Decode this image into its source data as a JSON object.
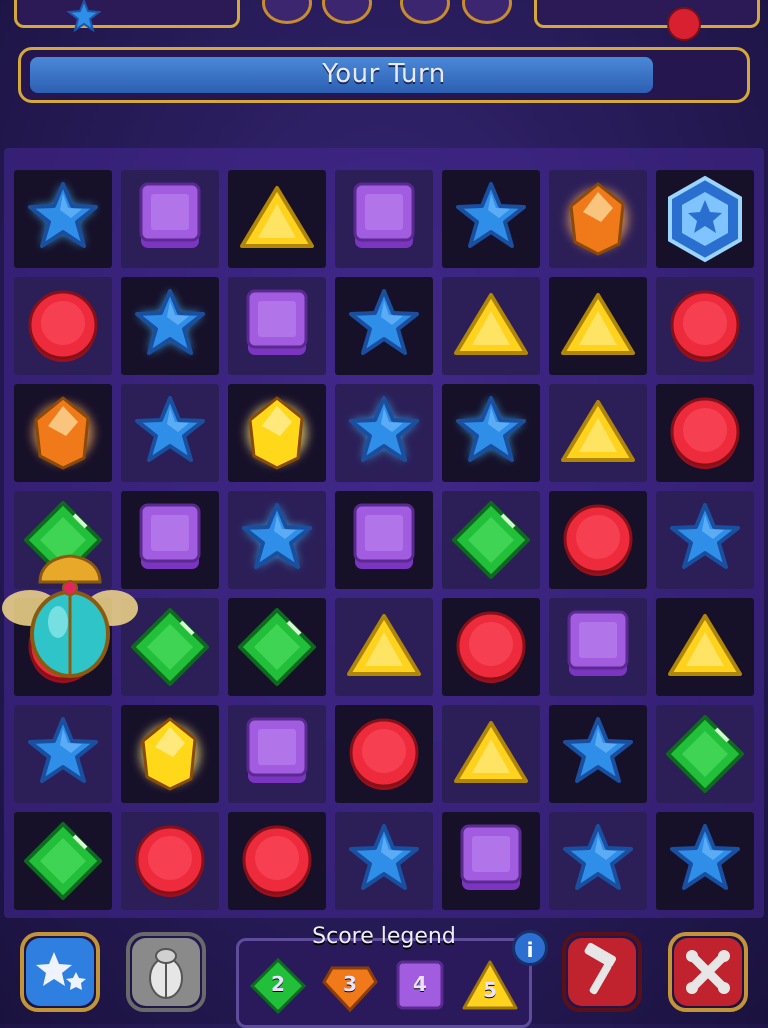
{
  "turn_indicator": {
    "label": "Your Turn",
    "timer_fraction": 0.88
  },
  "board": {
    "rows": 7,
    "cols": 7,
    "grid": [
      [
        "star-glow",
        "square",
        "triangle",
        "square",
        "star",
        "crystal-orange",
        "hex-star"
      ],
      [
        "circle",
        "star-glow",
        "square",
        "star",
        "triangle",
        "triangle",
        "circle"
      ],
      [
        "crystal-orange",
        "star",
        "crystal-yellow",
        "star-glow",
        "star-glow",
        "triangle",
        "circle"
      ],
      [
        "diamond",
        "square",
        "star-glow",
        "square",
        "diamond",
        "circle",
        "star"
      ],
      [
        "circle",
        "diamond",
        "diamond",
        "triangle",
        "circle",
        "square",
        "triangle"
      ],
      [
        "star",
        "crystal-yellow",
        "square",
        "circle",
        "triangle",
        "star",
        "diamond"
      ],
      [
        "diamond",
        "circle",
        "circle",
        "star",
        "square",
        "star",
        "star"
      ]
    ]
  },
  "overlay": {
    "icon": "scarab-icon"
  },
  "legend": {
    "title": "Score legend",
    "info_label": "i",
    "items": [
      {
        "gem": "diamond",
        "value": "2"
      },
      {
        "gem": "crystal-orange-flat",
        "value": "3"
      },
      {
        "gem": "square",
        "value": "4"
      },
      {
        "gem": "triangle",
        "value": "5"
      }
    ]
  },
  "tools": [
    {
      "name": "stars-powerup-button",
      "icon": "stars-icon",
      "color": "#2f7fe0"
    },
    {
      "name": "scarab-powerup-button",
      "icon": "scarab-icon",
      "color": "#8a8a8a"
    },
    {
      "name": "hammer-button",
      "icon": "hammer-icon",
      "color": "#c0232d"
    },
    {
      "name": "shuffle-button",
      "icon": "shuffle-icon",
      "color": "#c0232d"
    }
  ],
  "colors": {
    "star": "#2f8fe8",
    "square": "#a25ce0",
    "triangle": "#ffd21e",
    "circle": "#ee2b3c",
    "diamond": "#22c03a",
    "crystal-orange": "#f07a1a",
    "crystal-yellow": "#ffd81a",
    "frame-gold": "#d4a93a"
  }
}
